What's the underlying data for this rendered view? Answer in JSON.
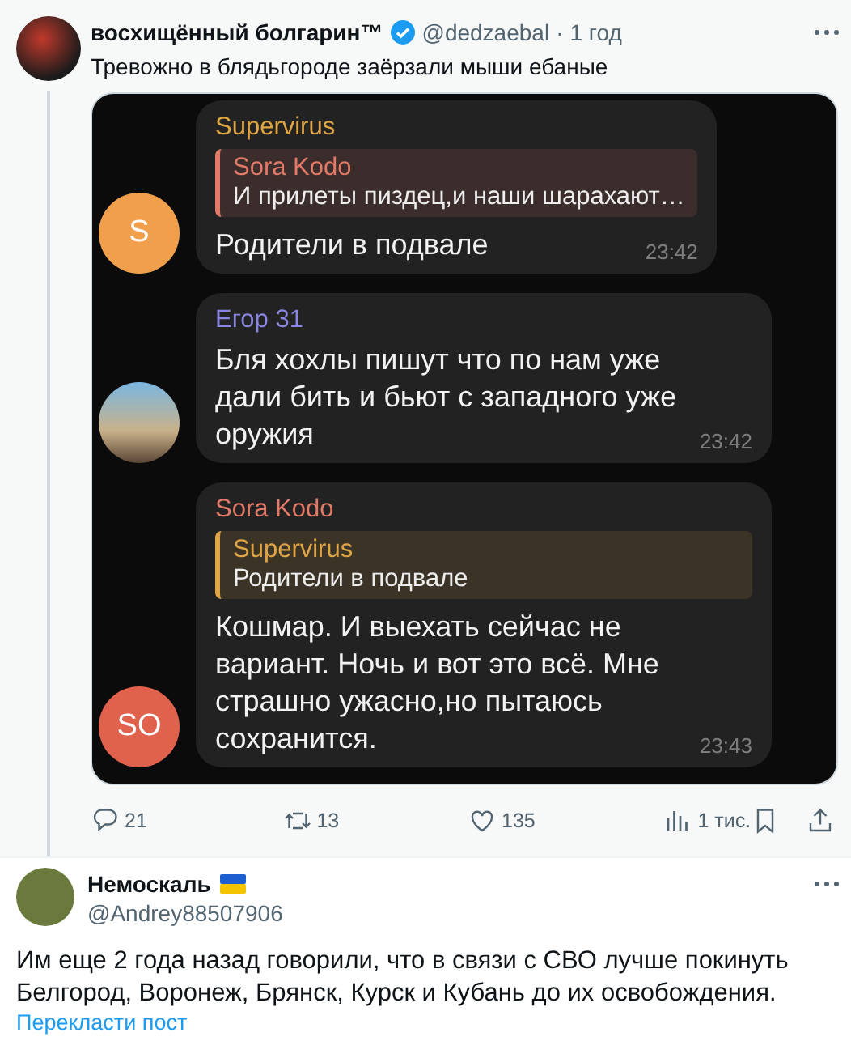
{
  "tweet": {
    "author": "восхищённый болгарин™",
    "verified": true,
    "handle": "@dedzaebal",
    "separator": "·",
    "time": "1 год",
    "text": "Тревожно в блядьгороде заёрзали мыши ебаные",
    "chat": {
      "messages": [
        {
          "sender": "Supervirus",
          "color": "#e0a545",
          "avatar": {
            "kind": "initials",
            "text": "S",
            "color": "#f0a04c"
          },
          "reply": {
            "sender": "Sora Kodo",
            "color": "#e37a68",
            "text": "И прилеты пиздец,и наши шарахают…"
          },
          "text": "Родители в подвале",
          "time": "23:42"
        },
        {
          "sender": "Егор 31",
          "color": "#8a86e0",
          "avatar": {
            "kind": "photo"
          },
          "text": "Бля хохлы пишут что по нам уже дали бить и бьют с западного уже оружия",
          "time": "23:42"
        },
        {
          "sender": "Sora Kodo",
          "color": "#e37a68",
          "avatar": {
            "kind": "initials",
            "text": "SO",
            "color": "#e0614c"
          },
          "reply": {
            "sender": "Supervirus",
            "color": "#e0a545",
            "text": "Родители в подвале"
          },
          "text": "Кошмар. И выехать сейчас не вариант. Ночь и вот это всё. Мне страшно ужасно,но пытаюсь сохранится.",
          "time": "23:43"
        }
      ]
    },
    "actions": [
      {
        "kind": "reply",
        "count": "21"
      },
      {
        "kind": "retweet",
        "count": "13"
      },
      {
        "kind": "like",
        "count": "135"
      },
      {
        "kind": "views",
        "count": "1 тис."
      },
      {
        "kind": "bookmark"
      },
      {
        "kind": "share"
      }
    ]
  },
  "reply_tweet": {
    "author": "Немоскаль",
    "flag": true,
    "handle": "@Andrey88507906",
    "text": "Им еще 2 года назад говорили, что в связи с СВО лучше покинуть Белгород, Воронеж, Брянск, Курск и Кубань до их освобождения.",
    "translate_link": "Перекласти пост"
  }
}
